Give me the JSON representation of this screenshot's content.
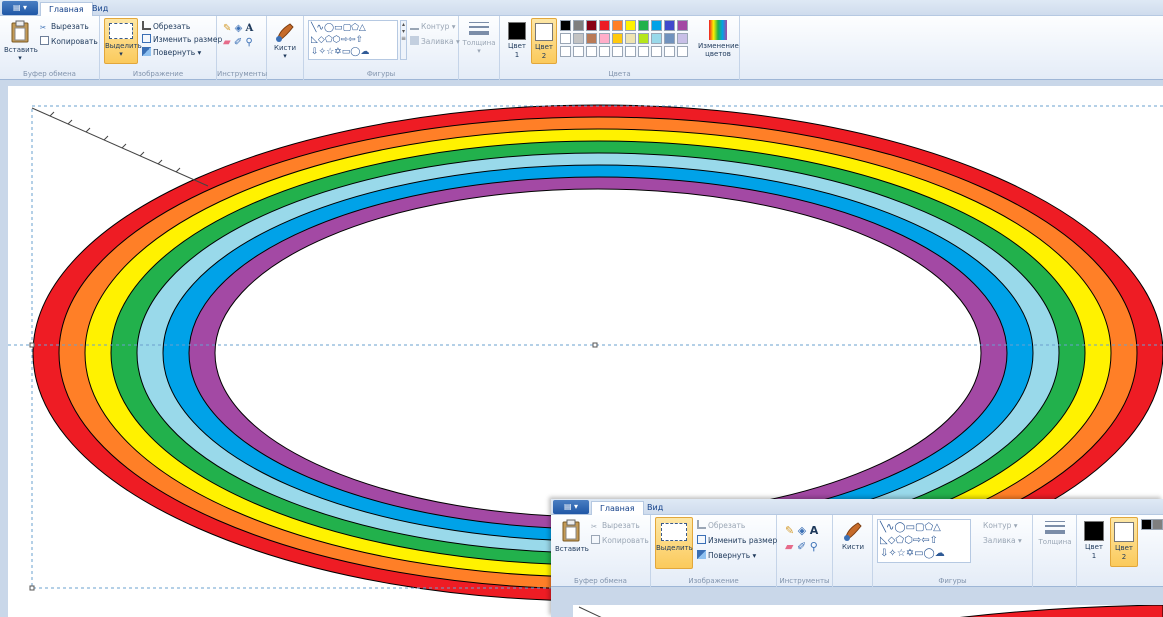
{
  "ribbon": {
    "app_button": "▾",
    "tabs": [
      {
        "label": "Главная",
        "active": true
      },
      {
        "label": "Вид",
        "active": false
      }
    ],
    "clipboard": {
      "paste": "Вставить",
      "cut": "Вырезать",
      "copy": "Копировать",
      "group": "Буфер обмена"
    },
    "image": {
      "select": "Выделить",
      "crop": "Обрезать",
      "resize": "Изменить размер",
      "rotate": "Повернуть ▾",
      "group": "Изображение"
    },
    "tools": {
      "group": "Инструменты",
      "text_tool": "A"
    },
    "brushes": {
      "label": "Кисти"
    },
    "shapes": {
      "outline": "Контур ▾",
      "fill": "Заливка ▾",
      "group": "Фигуры"
    },
    "thickness": {
      "label": "Толщина"
    },
    "colors": {
      "color1": "Цвет 1",
      "color2": "Цвет 2",
      "edit": "Изменение цветов",
      "group": "Цвета",
      "palette_top": [
        "#000000",
        "#7f7f7f",
        "#880015",
        "#ed1c24",
        "#ff7f27",
        "#fff200",
        "#22b14c",
        "#00a2e8",
        "#3f48cc",
        "#a349a4"
      ],
      "palette_bottom": [
        "#ffffff",
        "#c3c3c3",
        "#b97a57",
        "#ffaec9",
        "#ffc90e",
        "#efe4b0",
        "#b5e61d",
        "#99d9ea",
        "#7092be",
        "#c8bfe7"
      ]
    }
  },
  "rainbow": {
    "colors": [
      "#ee1c24",
      "#ff7f27",
      "#fff200",
      "#22b14c",
      "#99d9ea",
      "#00a2e8",
      "#a349a4"
    ]
  },
  "window2": {
    "tabs": [
      {
        "label": "Главная"
      },
      {
        "label": "Вид"
      }
    ],
    "clipboard": {
      "paste": "Вставить",
      "cut": "Вырезать",
      "copy": "Копировать",
      "group": "Буфер обмена"
    },
    "image": {
      "select": "Выделить",
      "crop": "Обрезать",
      "resize": "Изменить размер",
      "rotate": "Повернуть ▾",
      "group": "Изображение"
    },
    "tools_group": "Инструменты",
    "brushes": "Кисти",
    "shapes": {
      "outline": "Контур ▾",
      "fill": "Заливка ▾",
      "group": "Фигуры"
    },
    "thickness": "Толщина",
    "color1": "Цвет 1",
    "color2": "Цвет 2"
  }
}
